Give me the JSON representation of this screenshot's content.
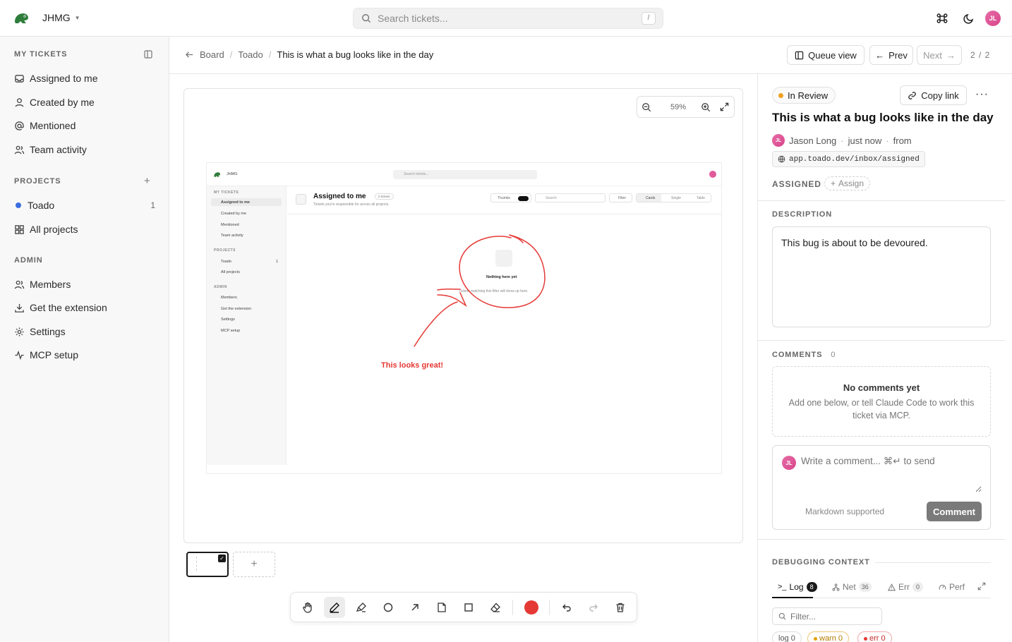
{
  "topbar": {
    "workspace": "JHMG",
    "search_placeholder": "Search tickets...",
    "search_shortcut": "/",
    "avatar_initials": "JL"
  },
  "sidebar": {
    "my_tickets_heading": "MY TICKETS",
    "my_tickets": [
      {
        "label": "Assigned to me",
        "icon": "inbox-icon"
      },
      {
        "label": "Created by me",
        "icon": "user-icon"
      },
      {
        "label": "Mentioned",
        "icon": "at-icon"
      },
      {
        "label": "Team activity",
        "icon": "users-icon"
      }
    ],
    "projects_heading": "PROJECTS",
    "projects": [
      {
        "label": "Toado",
        "count": "1",
        "color": "#3b6fe0"
      },
      {
        "label": "All projects",
        "icon": "grid-icon"
      }
    ],
    "admin_heading": "ADMIN",
    "admin": [
      {
        "label": "Members",
        "icon": "users-icon"
      },
      {
        "label": "Get the extension",
        "icon": "download-icon"
      },
      {
        "label": "Settings",
        "icon": "gear-icon"
      },
      {
        "label": "MCP setup",
        "icon": "activity-icon"
      }
    ]
  },
  "breadcrumb": {
    "board": "Board",
    "project": "Toado",
    "current": "This is what a bug looks like in the day"
  },
  "nav": {
    "queue_view": "Queue view",
    "prev": "Prev",
    "next": "Next",
    "pager": "2 / 2"
  },
  "canvas": {
    "zoom": "59%",
    "annotation_text": "This looks great!",
    "annotation_color": "#e53935"
  },
  "mini_screenshot": {
    "workspace": "JHMG",
    "search": "Search tickets...",
    "heading": "Assigned to me",
    "tickets_badge": "0 tickets",
    "subtitle": "Tickets you're responsible for across all projects.",
    "thumbs": "Thumbs",
    "search_small": "Search",
    "filter": "Filter",
    "cards": "Cards",
    "single": "Single",
    "table": "Table",
    "empty_title": "Nothing here yet",
    "empty_sub": "Tickets matching this filter will show up here.",
    "my_tickets": "MY TICKETS",
    "items": [
      "Assigned to me",
      "Created by me",
      "Mentioned",
      "Team activity"
    ],
    "projects": "PROJECTS",
    "project_items": [
      "Toado",
      "All projects"
    ],
    "project_count": "1",
    "admin": "ADMIN",
    "admin_items": [
      "Members",
      "Get the extension",
      "Settings",
      "MCP setup"
    ]
  },
  "ticket": {
    "status": "In Review",
    "status_color": "#f0a020",
    "copy_link": "Copy link",
    "title": "This is what a bug looks like in the day",
    "author": "Jason Long",
    "author_initials": "JL",
    "time": "just now",
    "from": "from",
    "url": "app.toado.dev/inbox/assigned",
    "assigned_label": "ASSIGNED",
    "assign_button": "Assign",
    "description_label": "DESCRIPTION",
    "description": "This bug is about to be devoured.",
    "comments_label": "COMMENTS",
    "comments_count": "0",
    "no_comments_title": "No comments yet",
    "no_comments_sub": "Add one below, or tell Claude Code to work this ticket via MCP.",
    "comment_placeholder": "Write a comment... ⌘↵ to send",
    "markdown_hint": "Markdown supported",
    "comment_button": "Comment"
  },
  "debug": {
    "label": "DEBUGGING CONTEXT",
    "tabs": [
      {
        "label": "Log",
        "count": "8"
      },
      {
        "label": "Net",
        "count": "36"
      },
      {
        "label": "Err",
        "count": "0"
      },
      {
        "label": "Perf",
        "count": ""
      }
    ],
    "filter_placeholder": "Filter...",
    "chips": [
      {
        "label": "log 0"
      },
      {
        "label": "warn 0",
        "color": "#e6a000"
      },
      {
        "label": "err 0",
        "color": "#e53935"
      }
    ]
  }
}
